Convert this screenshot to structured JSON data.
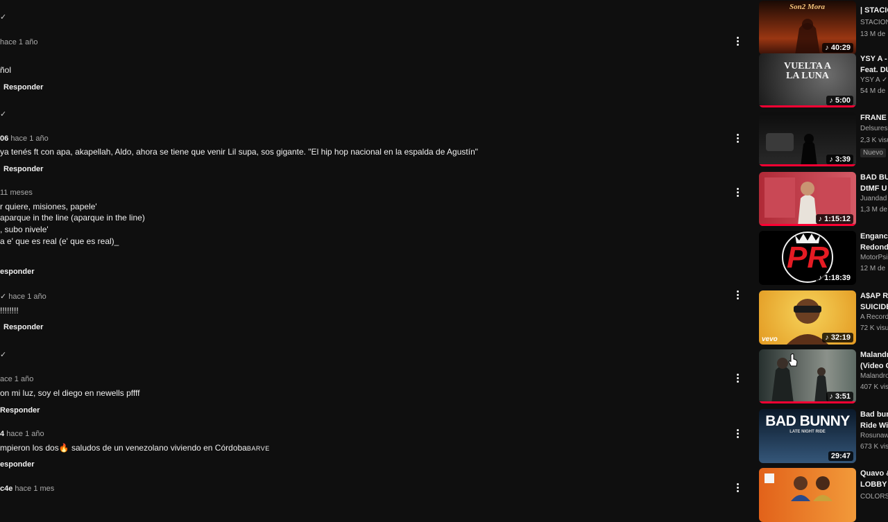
{
  "comments": [
    {
      "user": "",
      "verified": true,
      "time": "hace 1 año",
      "lines": [
        "ñol"
      ],
      "reply": "Responder"
    },
    {
      "user": "06",
      "verified": true,
      "time": "hace 1 año",
      "lines": [
        "ya tenés ft con apa, akapellah, Aldo, ahora se tiene que venir Lil supa, sos gigante. \"El hip hop nacional en la espalda de Agustín\""
      ],
      "reply": "Responder"
    },
    {
      "user": "",
      "verified": false,
      "time": "11 meses",
      "lines": [
        "r quiere, misiones, papele'",
        "aparque in the line (aparque in the line)",
        ", subo nivele'",
        "a e' que es real (e' que es real)_"
      ],
      "reply": "esponder"
    },
    {
      "user": "",
      "verified": true,
      "time": "hace 1 año",
      "lines": [
        "!!!!!!!!"
      ],
      "reply": "Responder"
    },
    {
      "user": "",
      "verified": true,
      "time": "ace 1 año",
      "lines": [
        "on mi luz, soy el diego en newells pffff"
      ],
      "reply": "Responder"
    },
    {
      "user": "4",
      "verified": false,
      "time": "hace 1 año",
      "lines": [
        "mpieron los dos🔥 saludos de un venezolano viviendo en Córdoba"
      ],
      "watermark": "BARVE",
      "reply": "esponder"
    },
    {
      "user": "c4e",
      "verified": false,
      "time": "hace 1 mes",
      "lines": [],
      "reply": ""
    }
  ],
  "recommendations": [
    {
      "title": [
        "| STACIO"
      ],
      "channel": "STACION",
      "views": "13 M de",
      "duration": "40:29",
      "thumb_text": "Son2 Mora",
      "colors": [
        "#3a1208",
        "#9a3612"
      ]
    },
    {
      "title": [
        "YSY A -",
        "Feat. DU"
      ],
      "channel": "YSY A",
      "views": "54 M de",
      "duration": "5:00",
      "thumb_text": "VUELTA A LA LUNA",
      "colors": [
        "#1e1e1e",
        "#5a5a5a"
      ]
    },
    {
      "title": [
        "FRANE"
      ],
      "channel": "Delsures",
      "views": "2,3 K visu",
      "duration": "3:39",
      "badge": "Nuevo",
      "colors": [
        "#0b0b0b",
        "#262626"
      ]
    },
    {
      "title": [
        "BAD BU",
        "DtMF U"
      ],
      "channel": "Juandad",
      "views": "1,3 M de",
      "duration": "1:15:12",
      "colors": [
        "#b8343f",
        "#d86a73"
      ]
    },
    {
      "title": [
        "Engancl",
        "Redond"
      ],
      "channel": "MotorPsi",
      "views": "12 M de",
      "duration": "1:18:39",
      "thumb_text": "PR",
      "colors": [
        "#000000",
        "#000000"
      ]
    },
    {
      "title": [
        "A$AP R",
        "SUICIDE"
      ],
      "channel": "A Record",
      "views": "72 K visu",
      "duration": "32:19",
      "thumb_text": "vevo",
      "colors": [
        "#e7a52a",
        "#f4cc4b"
      ]
    },
    {
      "title": [
        "Malandr",
        "(Video C"
      ],
      "channel": "Malandro",
      "views": "407 K vis",
      "duration": "3:51",
      "colors": [
        "#2f3a3a",
        "#8a8f86"
      ]
    },
    {
      "title": [
        "Bad bun",
        "Ride Wit"
      ],
      "channel": "Rosunaw",
      "views": "673 K visu",
      "duration": "29:47",
      "thumb_text": "BAD BUNNY",
      "thumb_sub": "LATE NIGHT RIDE",
      "colors": [
        "#0d1e30",
        "#2d4c6e"
      ]
    },
    {
      "title": [
        "Quavo &",
        "LOBBY"
      ],
      "channel": "COLORS",
      "views": "",
      "duration": "",
      "colors": [
        "#e86b1e",
        "#f08a2f"
      ]
    }
  ]
}
